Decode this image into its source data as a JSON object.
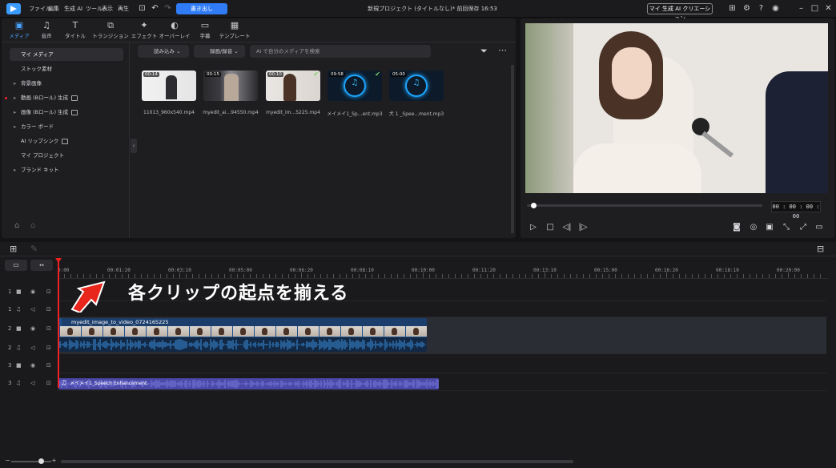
{
  "menu": [
    "ファイル",
    "編集",
    "生成 AI",
    "ツール",
    "表示",
    "再生"
  ],
  "export_label": "書き出し",
  "project_title": "新規プロジェクト (タイトルなし)* 前回保存 16:53",
  "ai_creation_label": "マイ 生成 AI クリエーション",
  "tabs": [
    {
      "label": "メディア",
      "icon": "▣"
    },
    {
      "label": "音声",
      "icon": "♫"
    },
    {
      "label": "タイトル",
      "icon": "T"
    },
    {
      "label": "トランジション",
      "icon": "⧉"
    },
    {
      "label": "エフェクト",
      "icon": "✦"
    },
    {
      "label": "オーバーレイ",
      "icon": "◐"
    },
    {
      "label": "字幕",
      "icon": "▭"
    },
    {
      "label": "テンプレート",
      "icon": "▦"
    }
  ],
  "sidebar": [
    {
      "label": "マイ メディア",
      "arrow": "",
      "ai": false
    },
    {
      "label": "ストック素材",
      "arrow": "",
      "ai": false
    },
    {
      "label": "背景画像",
      "arrow": "▸",
      "ai": false
    },
    {
      "label": "動画 (Bロール) 生成",
      "arrow": "▸",
      "ai": true
    },
    {
      "label": "画像 (Bロール) 生成",
      "arrow": "▸",
      "ai": true
    },
    {
      "label": "カラー ボード",
      "arrow": "▸",
      "ai": false
    },
    {
      "label": "AI リップシンク",
      "arrow": "",
      "ai": true
    },
    {
      "label": "マイ プロジェクト",
      "arrow": "",
      "ai": false
    },
    {
      "label": "ブランド キット",
      "arrow": "▸",
      "ai": false
    }
  ],
  "media_toolbar": {
    "import": "読み込み",
    "record": "録画/録音",
    "search_placeholder": "AI で自分のメディアを検索"
  },
  "media": [
    {
      "duration": "00:14",
      "name": "11013_960x540.mp4",
      "type": "video",
      "checked": false
    },
    {
      "duration": "00:15",
      "name": "myedit_ai...94550.mp4",
      "type": "video",
      "checked": false
    },
    {
      "duration": "00:10",
      "name": "myedit_im...5225.mp4",
      "type": "video",
      "checked": true
    },
    {
      "duration": "09:58",
      "name": "メイメイ1_Sp...ent.mp3",
      "type": "audio",
      "checked": true
    },
    {
      "duration": "05:00",
      "name": "犬 1 _Spee...ment.mp3",
      "type": "audio",
      "checked": false
    }
  ],
  "preview": {
    "timecode": "00 : 00 : 00 : 00",
    "progress": 0
  },
  "ruler": [
    "0:00",
    "00:01:20",
    "00:03:10",
    "00:05:00",
    "00:06:20",
    "00:08:10",
    "00:10:00",
    "00:11:20",
    "00:13:10",
    "00:15:00",
    "00:16:20",
    "00:18:10",
    "00:20:00"
  ],
  "tracks": [
    {
      "num": "1",
      "kind": "video"
    },
    {
      "num": "1",
      "kind": "audio"
    },
    {
      "num": "2",
      "kind": "video"
    },
    {
      "num": "2",
      "kind": "audio"
    },
    {
      "num": "3",
      "kind": "video"
    },
    {
      "num": "3",
      "kind": "audio"
    }
  ],
  "video_clip_name": "myedit_image_to_video_0724165225",
  "audio_clip_name": "メイメイ1_Speech Enhancement",
  "caption": "各クリップの起点を揃える",
  "colors": {
    "accent": "#2f7cf6",
    "playhead": "#e22222",
    "video_clip": "#1c4f8c",
    "audio_clip": "#4a49a8"
  }
}
